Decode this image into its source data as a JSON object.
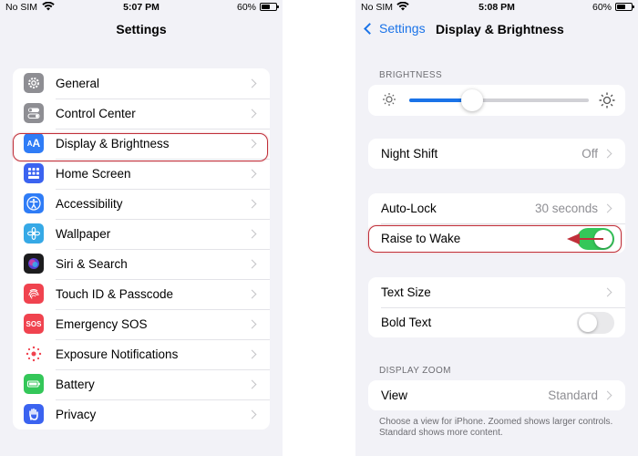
{
  "colors": {
    "accent": "#1a73e8",
    "toggle_on": "#34c759",
    "highlight": "#c0303a",
    "arrow": "#c0303a"
  },
  "left": {
    "status": {
      "carrier": "No SIM",
      "time": "5:07 PM",
      "battery": "60%",
      "battery_level": 0.6
    },
    "title": "Settings",
    "items": [
      {
        "label": "General",
        "icon": "gear-icon",
        "color": "#8e8e93"
      },
      {
        "label": "Control Center",
        "icon": "toggles-icon",
        "color": "#8e8e93"
      },
      {
        "label": "Display & Brightness",
        "icon": "text-size-icon",
        "color": "#2f7cf6",
        "highlighted": true
      },
      {
        "label": "Home Screen",
        "icon": "home-grid-icon",
        "color": "#3b63f0"
      },
      {
        "label": "Accessibility",
        "icon": "accessibility-icon",
        "color": "#2f7cf6"
      },
      {
        "label": "Wallpaper",
        "icon": "flower-icon",
        "color": "#36a9e6"
      },
      {
        "label": "Siri & Search",
        "icon": "siri-icon",
        "color": "#1c1c1e"
      },
      {
        "label": "Touch ID & Passcode",
        "icon": "fingerprint-icon",
        "color": "#f0434f"
      },
      {
        "label": "Emergency SOS",
        "icon": "sos-icon",
        "color": "#f0434f",
        "text": "SOS"
      },
      {
        "label": "Exposure Notifications",
        "icon": "exposure-icon",
        "color": "#ffffff"
      },
      {
        "label": "Battery",
        "icon": "battery-icon",
        "color": "#34c759"
      },
      {
        "label": "Privacy",
        "icon": "hand-icon",
        "color": "#3b63f0"
      }
    ]
  },
  "right": {
    "status": {
      "carrier": "No SIM",
      "time": "5:08 PM",
      "battery": "60%",
      "battery_level": 0.6
    },
    "back_label": "Settings",
    "title": "Display & Brightness",
    "brightness_header": "BRIGHTNESS",
    "brightness_level": 0.35,
    "night_shift": {
      "label": "Night Shift",
      "value": "Off"
    },
    "auto_lock": {
      "label": "Auto-Lock",
      "value": "30 seconds"
    },
    "raise_to_wake": {
      "label": "Raise to Wake",
      "on": true
    },
    "text_size": {
      "label": "Text Size"
    },
    "bold_text": {
      "label": "Bold Text",
      "on": false
    },
    "zoom_header": "DISPLAY ZOOM",
    "view": {
      "label": "View",
      "value": "Standard"
    },
    "zoom_footer": "Choose a view for iPhone. Zoomed shows larger controls. Standard shows more content."
  }
}
